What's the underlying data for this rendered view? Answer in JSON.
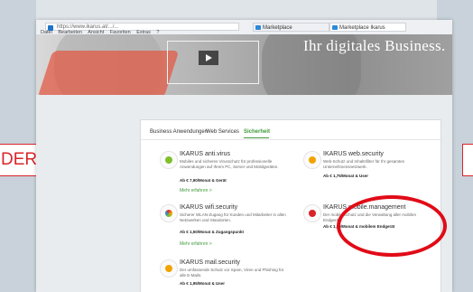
{
  "side_label_left": "DER",
  "browser": {
    "url": "https://www.ikarus.at/.../...",
    "tabs": [
      "Marketplace",
      "Marketplace Ikarus"
    ],
    "menu": [
      "Datei",
      "Bearbeiten",
      "Ansicht",
      "Favoriten",
      "Extras",
      "?"
    ]
  },
  "hero_text": "Ihr digitales Business.",
  "panel": {
    "tabs": [
      "Business Anwendungen",
      "Web Services",
      "Sicherheit"
    ],
    "cards": [
      {
        "title": "IKARUS anti.virus",
        "desc": "Mobiles und sicheres Virusschutz für professionelle Anwendungen auf Ihrem PC, Server und Mobilgeräten.",
        "price": "Ab € 7,90/Monat & Gerät",
        "more": "Mehr erfahren >"
      },
      {
        "title": "IKARUS web.security",
        "desc": "Web-Schutz und Inhaltsfilter für Ihr gesamtes Unternehmensnetzwerk.",
        "price": "Ab € 1,75/Monat & User",
        "more": ""
      },
      {
        "title": "IKARUS wifi.security",
        "desc": "Sicherer WLAN-Zugang für Kunden und Mitarbeiter in allen Netzwerken und Standorten.",
        "price": "Ab € 1,50/Monat & Zugangspunkt",
        "more": "Mehr erfahren >"
      },
      {
        "title": "IKARUS mobile.management",
        "desc": "Der mobile Schutz und die Verwaltung aller mobilen Endgeräte.",
        "price": "Ab € 1,50/Monat & mobilem Endgerät",
        "more": ""
      },
      {
        "title": "IKARUS mail.security",
        "desc": "Der umfassende Schutz vor Spam, Viren und Phishing für alle E-Mails.",
        "price": "Ab € 1,95/Monat & User",
        "more": ""
      }
    ]
  },
  "colors": {
    "accent_green": "#3f9a3a",
    "highlight_red": "#e10b17"
  }
}
